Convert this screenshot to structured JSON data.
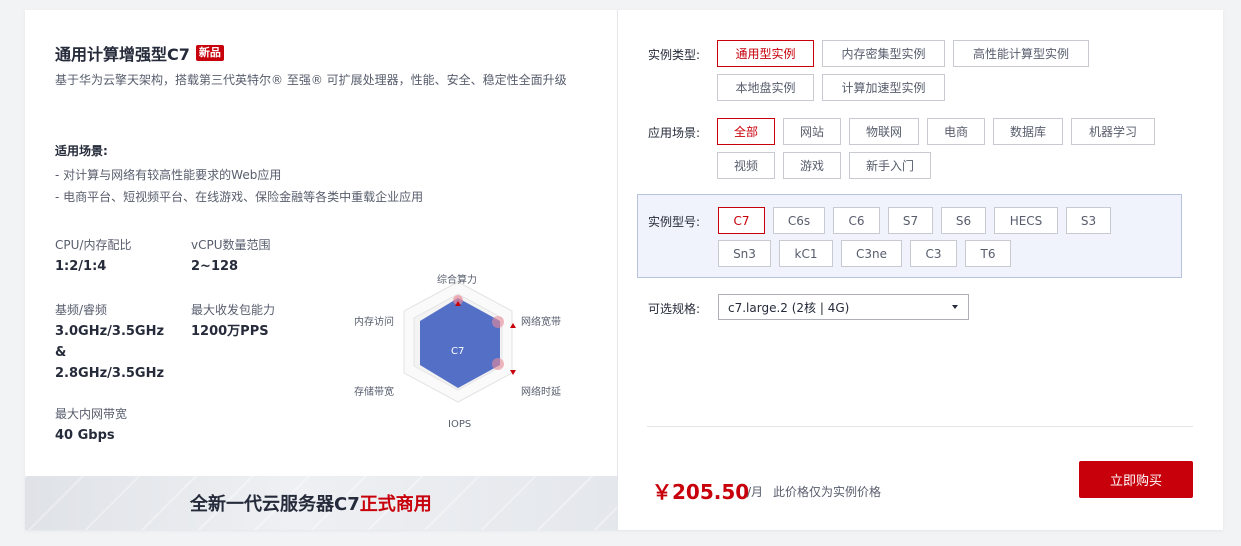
{
  "product": {
    "title": "通用计算增强型C7",
    "badge": "新品",
    "desc": "基于华为云擎天架构，搭载第三代英特尔® 至强® 可扩展处理器，性能、安全、稳定性全面升级",
    "scene_title": "适用场景:",
    "scenes": [
      "对计算与网络有较高性能要求的Web应用",
      "电商平台、短视频平台、在线游戏、保险金融等各类中重载企业应用"
    ]
  },
  "specs": {
    "cpu_mem": {
      "label": "CPU/内存配比",
      "value": "1:2/1:4"
    },
    "vcpu": {
      "label": "vCPU数量范围",
      "value": "2~128"
    },
    "freq": {
      "label": "基频/睿频",
      "value1": "3.0GHz/3.5GHz",
      "value2": "&",
      "value3": "2.8GHz/3.5GHz"
    },
    "pps": {
      "label": "最大收发包能力",
      "value": "1200万PPS"
    },
    "bandwidth": {
      "label": "最大内网带宽",
      "value": "40 Gbps"
    }
  },
  "radar": {
    "center": "C7",
    "labels": {
      "top": "综合算力",
      "right_top": "网络宽带",
      "right_bottom": "网络时延",
      "bottom": "IOPS",
      "left_bottom": "存储带宽",
      "left_top": "内存访问"
    },
    "fill_color": "#5470c6"
  },
  "banner": {
    "text_main": "全新一代云服务器C7",
    "text_hl": "正式商用"
  },
  "filters": {
    "instance_type": {
      "label": "实例类型:",
      "options": [
        "通用型实例",
        "内存密集型实例",
        "高性能计算型实例",
        "本地盘实例",
        "计算加速型实例"
      ],
      "selected": "通用型实例"
    },
    "scenario": {
      "label": "应用场景:",
      "options": [
        "全部",
        "网站",
        "物联网",
        "电商",
        "数据库",
        "机器学习",
        "视频",
        "游戏",
        "新手入门"
      ],
      "selected": "全部"
    },
    "model": {
      "label": "实例型号:",
      "options": [
        "C7",
        "C6s",
        "C6",
        "S7",
        "S6",
        "HECS",
        "S3",
        "Sn3",
        "kC1",
        "C3ne",
        "C3",
        "T6"
      ],
      "selected": "C7"
    },
    "spec": {
      "label": "可选规格:",
      "value": "c7.large.2 (2核 | 4G)"
    }
  },
  "purchase": {
    "price": "￥205.50",
    "unit": "/月",
    "note": "此价格仅为实例价格",
    "buy_label": "立即购买"
  },
  "colors": {
    "accent": "#c7000b",
    "model_box_bg": "#f0f3fb"
  }
}
